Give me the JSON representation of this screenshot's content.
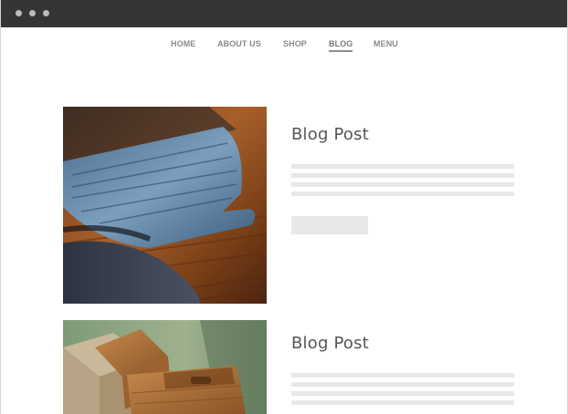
{
  "nav": {
    "items": [
      {
        "label": "HOME"
      },
      {
        "label": "ABOUT US"
      },
      {
        "label": "SHOP"
      },
      {
        "label": "BLOG"
      },
      {
        "label": "MENU"
      }
    ],
    "active": "BLOG"
  },
  "posts": [
    {
      "title": "Blog Post",
      "image": "cutting-board-photo"
    },
    {
      "title": "Blog Post",
      "image": "wooden-crates-photo"
    }
  ],
  "colors": {
    "titlebar": "#353535",
    "window_dots": "#bcbcbc",
    "nav_text": "#8a8a8a",
    "title_text": "#555555",
    "placeholder": "#e8e8e8"
  }
}
